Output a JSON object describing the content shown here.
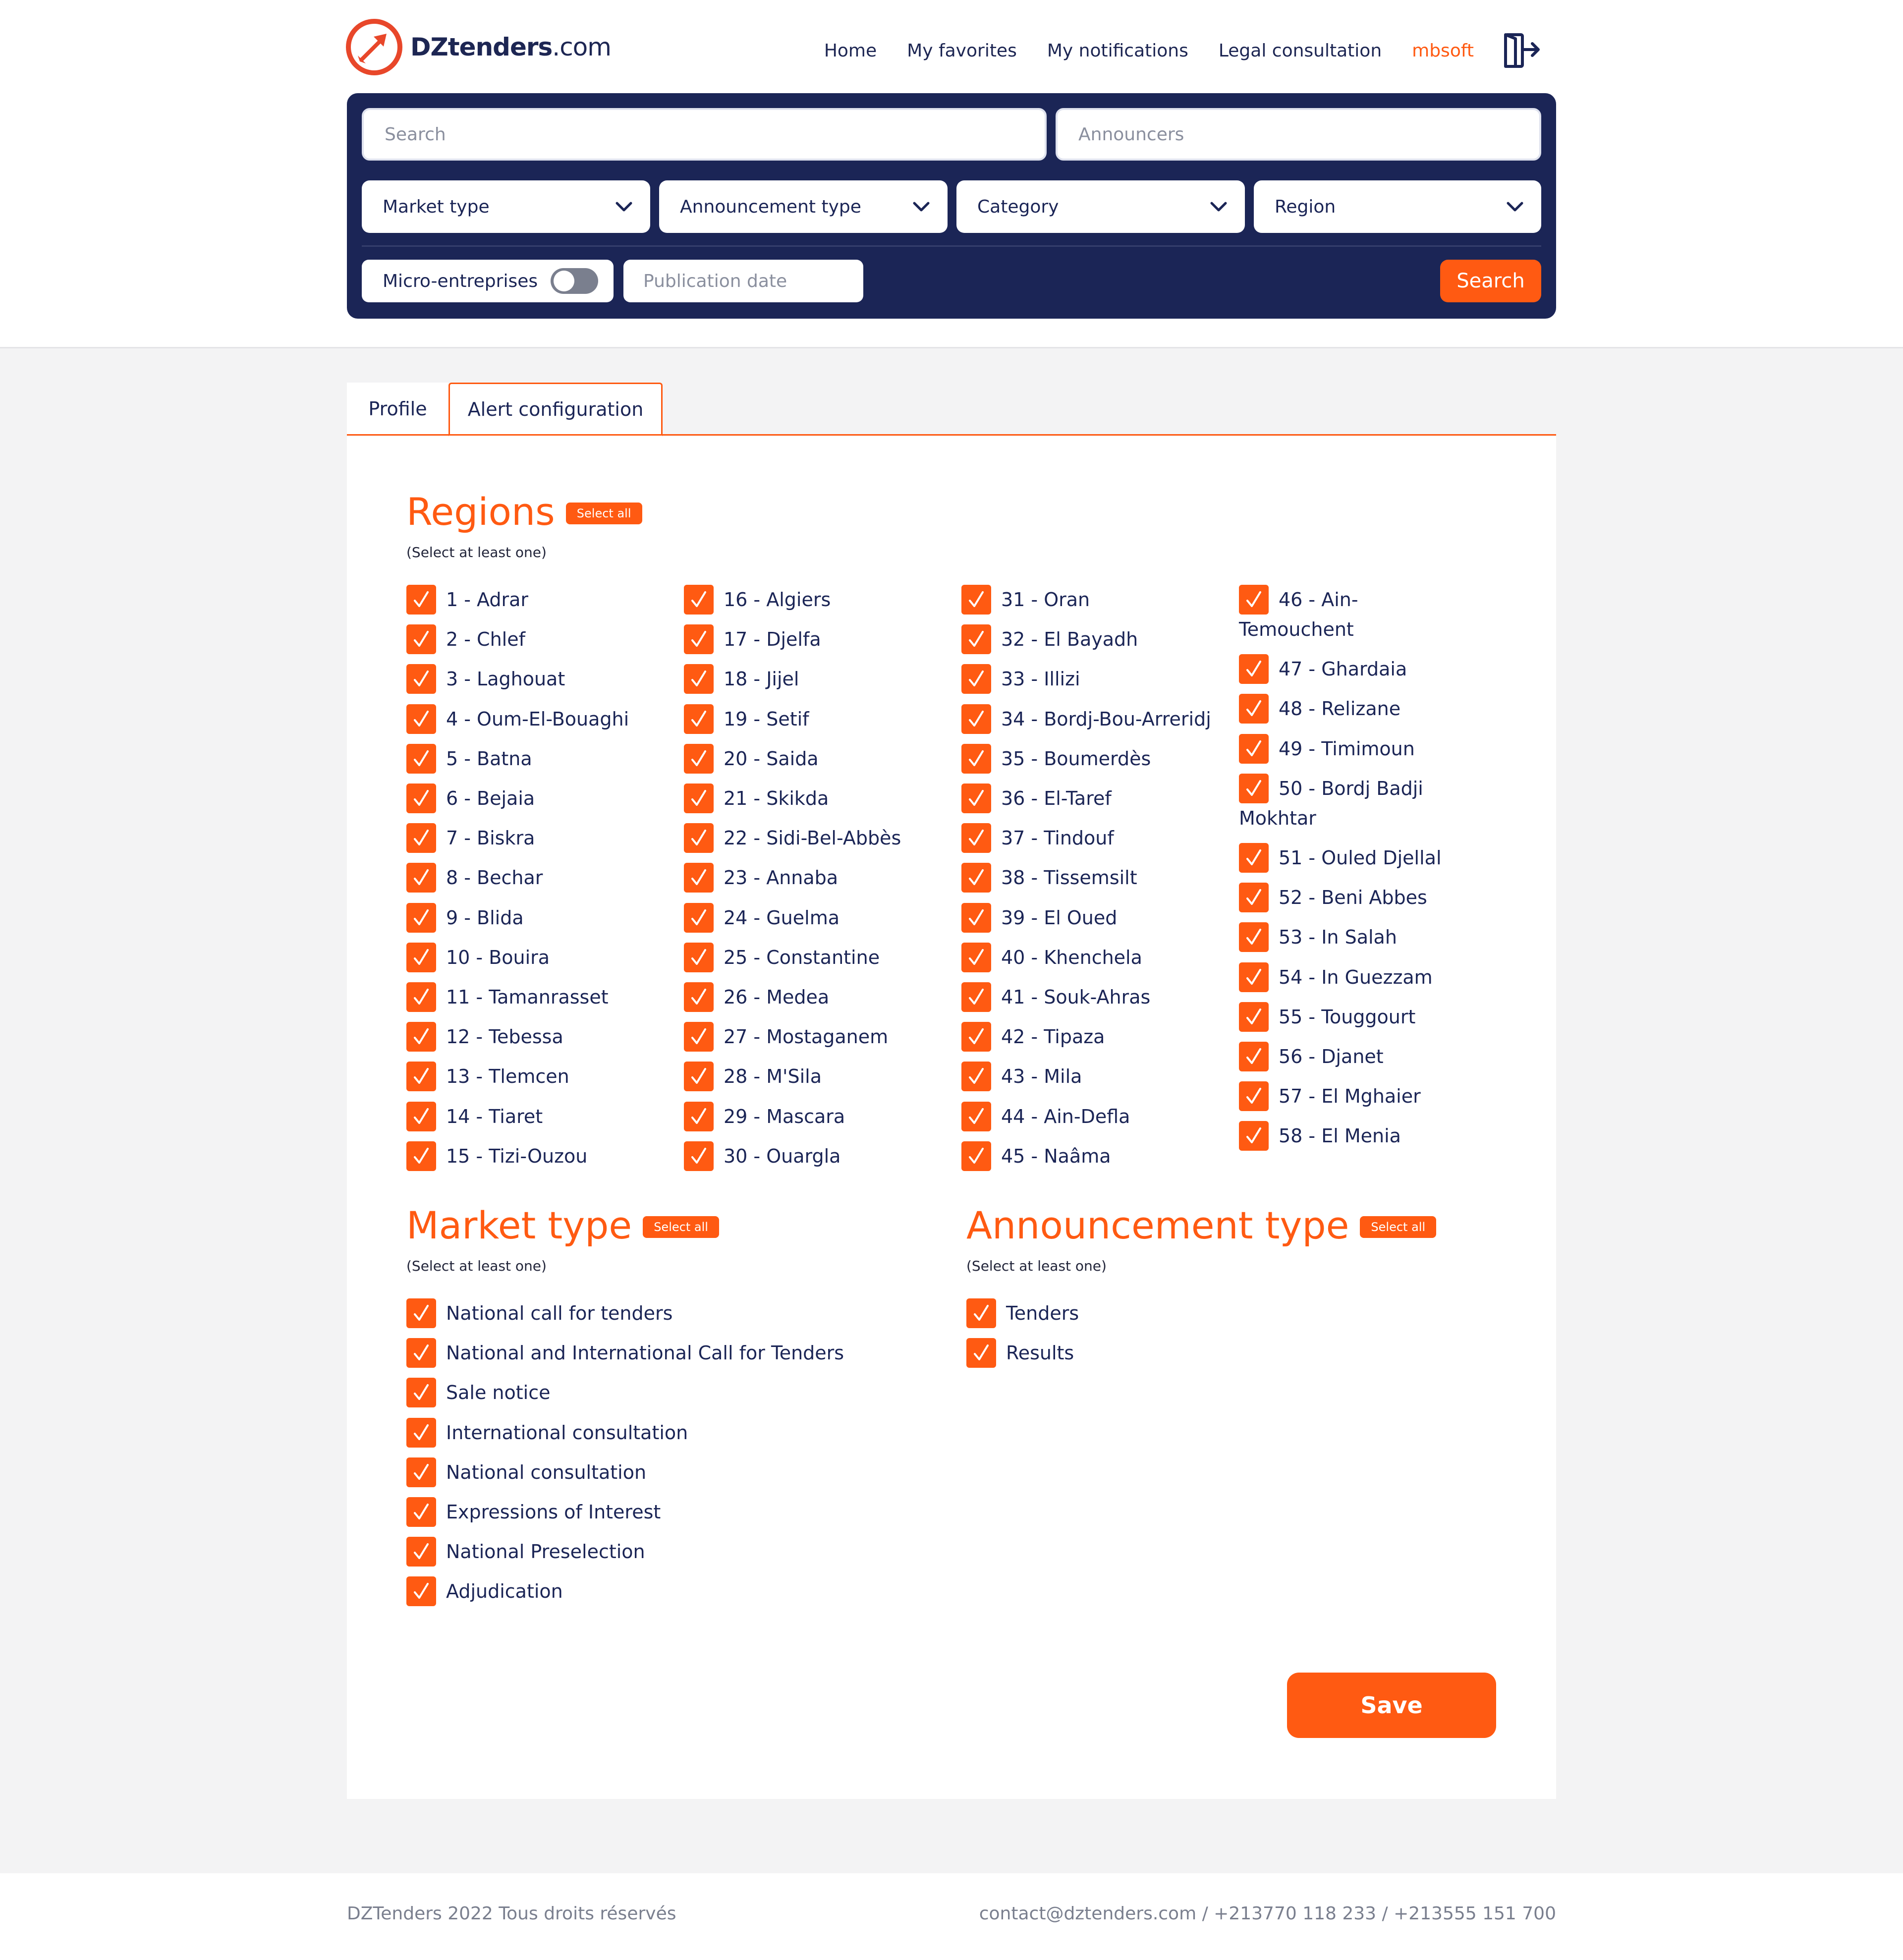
{
  "brand": {
    "logo_bold": "DZtenders",
    "logo_light": ".com"
  },
  "nav": {
    "home": "Home",
    "favorites": "My favorites",
    "notifications": "My notifications",
    "legal": "Legal consultation",
    "user": "mbsoft"
  },
  "search": {
    "search_placeholder": "Search",
    "announcers_placeholder": "Announcers",
    "market_type": "Market type",
    "announcement_type": "Announcement type",
    "category": "Category",
    "region": "Region",
    "micro_label": "Micro-entreprises",
    "micro_enabled": false,
    "publication_date_placeholder": "Publication date",
    "search_button": "Search"
  },
  "tabs": {
    "profile": "Profile",
    "alert": "Alert configuration",
    "active": "Alert configuration"
  },
  "regions": {
    "title": "Regions",
    "select_all": "Select all",
    "hint": "(Select at least one)",
    "columns": [
      [
        "1 - Adrar",
        "2 - Chlef",
        "3 - Laghouat",
        "4 - Oum-El-Bouaghi",
        "5 - Batna",
        "6 - Bejaia",
        "7 - Biskra",
        "8 - Bechar",
        "9 - Blida",
        "10 - Bouira",
        "11 - Tamanrasset",
        "12 - Tebessa",
        "13 - Tlemcen",
        "14 - Tiaret",
        "15 - Tizi-Ouzou"
      ],
      [
        "16 - Algiers",
        "17 - Djelfa",
        "18 - Jijel",
        "19 - Setif",
        "20 - Saida",
        "21 - Skikda",
        "22 - Sidi-Bel-Abbès",
        "23 - Annaba",
        "24 - Guelma",
        "25 - Constantine",
        "26 - Medea",
        "27 - Mostaganem",
        "28 - M'Sila",
        "29 - Mascara",
        "30 - Ouargla"
      ],
      [
        "31 - Oran",
        "32 - El Bayadh",
        "33 - Illizi",
        "34 - Bordj-Bou-Arreridj",
        "35 - Boumerdès",
        "36 - El-Taref",
        "37 - Tindouf",
        "38 - Tissemsilt",
        "39 - El Oued",
        "40 - Khenchela",
        "41 - Souk-Ahras",
        "42 - Tipaza",
        "43 - Mila",
        "44 - Ain-Defla",
        "45 - Naâma"
      ],
      [
        "46 - Ain-Temouchent",
        "47 - Ghardaia",
        "48 - Relizane",
        "49 - Timimoun",
        "50 - Bordj Badji Mokhtar",
        "51 - Ouled Djellal",
        "52 - Beni Abbes",
        "53 - In Salah",
        "54 - In Guezzam",
        "55 - Touggourt",
        "56 - Djanet",
        "57 - El Mghaier",
        "58 - El Menia"
      ]
    ]
  },
  "market_type": {
    "title": "Market type",
    "select_all": "Select all",
    "hint": "(Select at least one)",
    "items": [
      "National call for tenders",
      "National and International Call for Tenders",
      "Sale notice",
      "International consultation",
      "National consultation",
      "Expressions of Interest",
      "National Preselection",
      "Adjudication"
    ]
  },
  "announcement_type": {
    "title": "Announcement type",
    "select_all": "Select all",
    "hint": "(Select at least one)",
    "items": [
      "Tenders",
      "Results"
    ]
  },
  "save_button": "Save",
  "footer": {
    "copyright": "DZTenders 2022 Tous droits réservés",
    "contact": "contact@dztenders.com / +213770 118 233 / +213555 151 700"
  },
  "colors": {
    "accent": "#ff5a12",
    "navy": "#1b2556"
  },
  "icons": {
    "logo": "arrow-target-icon",
    "logout": "logout-icon",
    "checkbox": "checkmark-icon",
    "select": "chevron-down-icon"
  }
}
